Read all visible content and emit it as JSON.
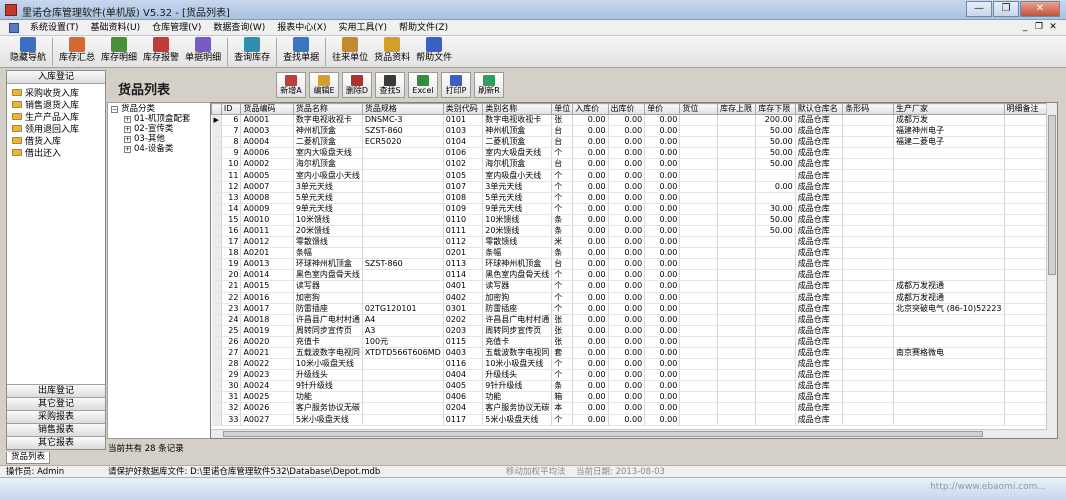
{
  "window": {
    "title": "里诺仓库管理软件(单机版) V5.32 - [货品列表]",
    "buttons": [
      "—",
      "❐",
      "✕"
    ]
  },
  "menu": {
    "items": [
      "系统设置(T)",
      "基础资料(U)",
      "仓库管理(V)",
      "数据查询(W)",
      "报表中心(X)",
      "实用工具(Y)",
      "帮助文件(Z)"
    ],
    "mdi_buttons": [
      "_",
      "❐",
      "✕"
    ]
  },
  "toolbar": {
    "items": [
      {
        "label": "隐藏导航",
        "color": "#3a6fc4"
      },
      {
        "label": "库存汇总",
        "color": "#d46a2f"
      },
      {
        "label": "库存明细",
        "color": "#4b8f3b"
      },
      {
        "label": "库存报警",
        "color": "#c23b3b"
      },
      {
        "label": "单据明细",
        "color": "#7a5ac4"
      },
      {
        "label": "查询库存",
        "color": "#2f8fb0"
      },
      {
        "label": "查找单据",
        "color": "#3b76c4"
      },
      {
        "label": "往来单位",
        "color": "#c4892f"
      },
      {
        "label": "货品资料",
        "color": "#d2a02a"
      },
      {
        "label": "帮助文件",
        "color": "#3b5fc4"
      }
    ]
  },
  "nav": {
    "top_header": "入库登记",
    "items": [
      "采购收货入库",
      "销售退货入库",
      "生产产品入库",
      "领用退回入库",
      "借货入库",
      "借出还入"
    ],
    "bottom_headers": [
      "出库登记",
      "其它登记",
      "采购报表",
      "销售报表",
      "其它报表"
    ]
  },
  "content": {
    "title": "货品列表",
    "buttons": [
      {
        "label": "新增A",
        "color": "#c23b3b"
      },
      {
        "label": "编辑E",
        "color": "#d4a02a"
      },
      {
        "label": "删除D",
        "color": "#b03030"
      },
      {
        "label": "查找S",
        "color": "#3a3a3a"
      },
      {
        "label": "Excel",
        "color": "#2f8f3b"
      },
      {
        "label": "打印P",
        "color": "#3b5fc4"
      },
      {
        "label": "刷新R",
        "color": "#2f9f5f"
      }
    ]
  },
  "tree": {
    "root": "货品分类",
    "children": [
      "01-机顶盒配套",
      "02-宣传类",
      "03-其他",
      "04-设备类"
    ]
  },
  "grid": {
    "columns": [
      "ID",
      "货品编码",
      "货品名称",
      "货品规格",
      "类别代码",
      "类别名称",
      "单位",
      "入库价",
      "出库价",
      "单价",
      "货位",
      "库存上限",
      "库存下限",
      "默认仓库名",
      "条形码",
      "生产厂家",
      "明细备注"
    ],
    "rows": [
      [
        "6",
        "A0001",
        "数字电视收视卡",
        "DNSMC-3",
        "0101",
        "数字电视收视卡",
        "张",
        "0.00",
        "0.00",
        "0.00",
        "",
        "",
        "200.00",
        "成品仓库",
        "",
        "成都万发",
        ""
      ],
      [
        "7",
        "A0003",
        "神州机顶盒",
        "SZST-860",
        "0103",
        "神州机顶盒",
        "台",
        "0.00",
        "0.00",
        "0.00",
        "",
        "",
        "50.00",
        "成品仓库",
        "",
        "福建神州电子",
        ""
      ],
      [
        "8",
        "A0004",
        "二菱机顶盒",
        "ECR5020",
        "0104",
        "二菱机顶盒",
        "台",
        "0.00",
        "0.00",
        "0.00",
        "",
        "",
        "50.00",
        "成品仓库",
        "",
        "福建二菱电子",
        ""
      ],
      [
        "9",
        "A0006",
        "室内大吸盘天线",
        "",
        "0106",
        "室内大吸盘天线",
        "个",
        "0.00",
        "0.00",
        "0.00",
        "",
        "",
        "50.00",
        "成品仓库",
        "",
        "",
        ""
      ],
      [
        "10",
        "A0002",
        "海尔机顶盒",
        "",
        "0102",
        "海尔机顶盒",
        "台",
        "0.00",
        "0.00",
        "0.00",
        "",
        "",
        "50.00",
        "成品仓库",
        "",
        "",
        ""
      ],
      [
        "11",
        "A0005",
        "室内小吸盘小天线",
        "",
        "0105",
        "室内吸盘小天线",
        "个",
        "0.00",
        "0.00",
        "0.00",
        "",
        "",
        "",
        "成品仓库",
        "",
        "",
        ""
      ],
      [
        "12",
        "A0007",
        "3单元天线",
        "",
        "0107",
        "3单元天线",
        "个",
        "0.00",
        "0.00",
        "0.00",
        "",
        "",
        "0.00",
        "成品仓库",
        "",
        "",
        ""
      ],
      [
        "13",
        "A0008",
        "5单元天线",
        "",
        "0108",
        "5单元天线",
        "个",
        "0.00",
        "0.00",
        "0.00",
        "",
        "",
        "",
        "成品仓库",
        "",
        "",
        ""
      ],
      [
        "14",
        "A0009",
        "9单元天线",
        "",
        "0109",
        "9单元天线",
        "个",
        "0.00",
        "0.00",
        "0.00",
        "",
        "",
        "30.00",
        "成品仓库",
        "",
        "",
        ""
      ],
      [
        "15",
        "A0010",
        "10米馈线",
        "",
        "0110",
        "10米馈线",
        "条",
        "0.00",
        "0.00",
        "0.00",
        "",
        "",
        "50.00",
        "成品仓库",
        "",
        "",
        ""
      ],
      [
        "16",
        "A0011",
        "20米馈线",
        "",
        "0111",
        "20米馈线",
        "条",
        "0.00",
        "0.00",
        "0.00",
        "",
        "",
        "50.00",
        "成品仓库",
        "",
        "",
        ""
      ],
      [
        "17",
        "A0012",
        "零散馈线",
        "",
        "0112",
        "零散馈线",
        "米",
        "0.00",
        "0.00",
        "0.00",
        "",
        "",
        "",
        "成品仓库",
        "",
        "",
        ""
      ],
      [
        "18",
        "A0201",
        "条幅",
        "",
        "0201",
        "条幅",
        "条",
        "0.00",
        "0.00",
        "0.00",
        "",
        "",
        "",
        "成品仓库",
        "",
        "",
        ""
      ],
      [
        "19",
        "A0013",
        "环球神州机顶盒",
        "SZST-860",
        "0113",
        "环球神州机顶盒",
        "台",
        "0.00",
        "0.00",
        "0.00",
        "",
        "",
        "",
        "成品仓库",
        "",
        "",
        ""
      ],
      [
        "20",
        "A0014",
        "黑色室内盘骨天线",
        "",
        "0114",
        "黑色室内盘骨天线",
        "个",
        "0.00",
        "0.00",
        "0.00",
        "",
        "",
        "",
        "成品仓库",
        "",
        "",
        ""
      ],
      [
        "21",
        "A0015",
        "读写器",
        "",
        "0401",
        "读写器",
        "个",
        "0.00",
        "0.00",
        "0.00",
        "",
        "",
        "",
        "成品仓库",
        "",
        "成都万发视通",
        ""
      ],
      [
        "22",
        "A0016",
        "加密狗",
        "",
        "0402",
        "加密狗",
        "个",
        "0.00",
        "0.00",
        "0.00",
        "",
        "",
        "",
        "成品仓库",
        "",
        "成都万发视通",
        ""
      ],
      [
        "23",
        "A0017",
        "防雷插座",
        "02TG120101",
        "0301",
        "防雷插座",
        "个",
        "0.00",
        "0.00",
        "0.00",
        "",
        "",
        "",
        "成品仓库",
        "",
        "北京突破电气 (86-10)52223",
        ""
      ],
      [
        "24",
        "A0018",
        "许昌县广电村村通",
        "A4",
        "0202",
        "许昌县广电村村通",
        "张",
        "0.00",
        "0.00",
        "0.00",
        "",
        "",
        "",
        "成品仓库",
        "",
        "",
        ""
      ],
      [
        "25",
        "A0019",
        "周转同步宣传页",
        "A3",
        "0203",
        "周转同步宣传页",
        "张",
        "0.00",
        "0.00",
        "0.00",
        "",
        "",
        "",
        "成品仓库",
        "",
        "",
        ""
      ],
      [
        "26",
        "A0020",
        "充值卡",
        "100元",
        "0115",
        "充值卡",
        "张",
        "0.00",
        "0.00",
        "0.00",
        "",
        "",
        "",
        "成品仓库",
        "",
        "",
        ""
      ],
      [
        "27",
        "A0021",
        "五载波数字电视同",
        "XTDTD566T606MD",
        "0403",
        "五载波数字电视同",
        "套",
        "0.00",
        "0.00",
        "0.00",
        "",
        "",
        "",
        "成品仓库",
        "",
        "南京赛格微电",
        ""
      ],
      [
        "28",
        "A0022",
        "10米小吸盘天线",
        "",
        "0116",
        "10米小吸盘天线",
        "个",
        "0.00",
        "0.00",
        "0.00",
        "",
        "",
        "",
        "成品仓库",
        "",
        "",
        ""
      ],
      [
        "29",
        "A0023",
        "升级线头",
        "",
        "0404",
        "升级线头",
        "个",
        "0.00",
        "0.00",
        "0.00",
        "",
        "",
        "",
        "成品仓库",
        "",
        "",
        ""
      ],
      [
        "30",
        "A0024",
        "9针升级线",
        "",
        "0405",
        "9针升级线",
        "条",
        "0.00",
        "0.00",
        "0.00",
        "",
        "",
        "",
        "成品仓库",
        "",
        "",
        ""
      ],
      [
        "31",
        "A0025",
        "功能",
        "",
        "0406",
        "功能",
        "箱",
        "0.00",
        "0.00",
        "0.00",
        "",
        "",
        "",
        "成品仓库",
        "",
        "",
        ""
      ],
      [
        "32",
        "A0026",
        "客户服务协议无碳",
        "",
        "0204",
        "客户服务协议无碳",
        "本",
        "0.00",
        "0.00",
        "0.00",
        "",
        "",
        "",
        "成品仓库",
        "",
        "",
        ""
      ],
      [
        "33",
        "A0027",
        "5米小吸盘天线",
        "",
        "0117",
        "5米小吸盘天线",
        "个",
        "0.00",
        "0.00",
        "0.00",
        "",
        "",
        "",
        "成品仓库",
        "",
        "",
        ""
      ]
    ]
  },
  "record_count": "当前共有 28 条记录",
  "bottom_tab": "货品列表",
  "status": {
    "operator": "操作员: Admin",
    "db_path": "请保护好数据库文件: D:\\里诺仓库管理软件532\\Database\\Depot.mdb",
    "cost_method": "移动加权平均法",
    "date": "当前日期: 2013-08-03"
  },
  "watermark": "http://www.ebaomi.com..."
}
